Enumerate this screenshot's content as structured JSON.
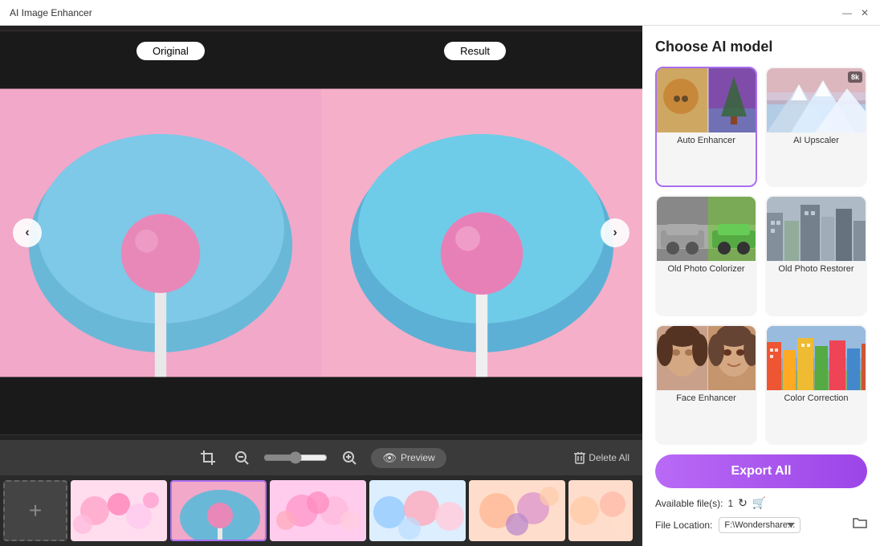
{
  "titleBar": {
    "title": "AI Image Enhancer",
    "minimizeLabel": "—",
    "closeLabel": "✕"
  },
  "imagePanel": {
    "labelOriginal": "Original",
    "labelResult": "Result",
    "navLeft": "‹",
    "navRight": "›"
  },
  "toolbar": {
    "zoomOut": "−",
    "zoomIn": "+",
    "previewLabel": "Preview",
    "deleteAllLabel": "Delete All"
  },
  "thumbnails": {
    "addLabel": "+"
  },
  "rightPanel": {
    "sectionTitle": "Choose AI model",
    "models": [
      {
        "id": "auto-enhancer",
        "label": "Auto Enhancer",
        "selected": true,
        "badge": null
      },
      {
        "id": "ai-upscaler",
        "label": "AI Upscaler",
        "selected": false,
        "badge": "8k"
      },
      {
        "id": "old-photo-colorizer",
        "label": "Old Photo Colorizer",
        "selected": false,
        "badge": null
      },
      {
        "id": "old-photo-restorer",
        "label": "Old Photo Restorer",
        "selected": false,
        "badge": null
      },
      {
        "id": "face-enhancer",
        "label": "Face Enhancer",
        "selected": false,
        "badge": null
      },
      {
        "id": "color-correction",
        "label": "Color Correction",
        "selected": false,
        "badge": null
      }
    ],
    "exportLabel": "Export All",
    "availableFilesLabel": "Available file(s):",
    "availableCount": "1",
    "fileLocationLabel": "File Location:",
    "fileLocationValue": "F:\\Wondershare..."
  }
}
